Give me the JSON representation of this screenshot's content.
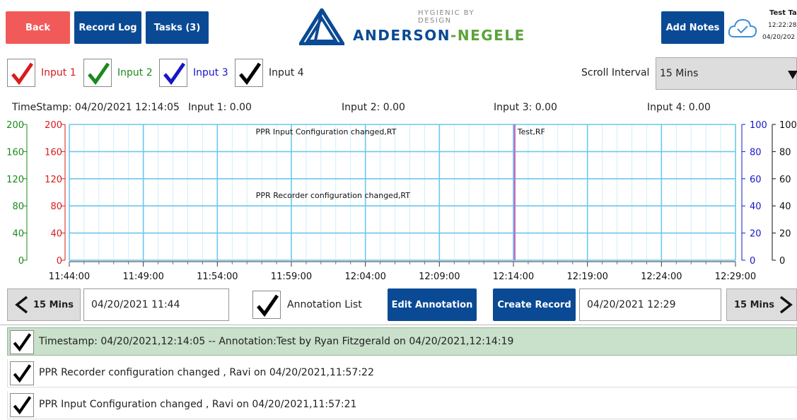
{
  "header": {
    "back_label": "Back",
    "record_log_label": "Record Log",
    "tasks_label": "Tasks (3)",
    "brand_tagline": "HYGIENIC BY DESIGN",
    "brand_name_a": "ANDERSON",
    "brand_name_sep": "-",
    "brand_name_b": "NEGELE",
    "add_notes_label": "Add Notes",
    "tag_name": "Test Tag",
    "time": "12:22:28",
    "date": "04/20/202"
  },
  "inputs": [
    {
      "label": "Input 1",
      "color": "#d81b1b"
    },
    {
      "label": "Input 2",
      "color": "#1a8a1a"
    },
    {
      "label": "Input 3",
      "color": "#1616c8"
    },
    {
      "label": "Input 4",
      "color": "#000000"
    }
  ],
  "scroll": {
    "label": "Scroll Interval",
    "value": "15 Mins"
  },
  "readout": {
    "timestamp": "TimeStamp: 04/20/2021 12:14:05",
    "input1": "Input 1: 0.00",
    "input2": "Input 2: 0.00",
    "input3": "Input 3: 0.00",
    "input4": "Input 4: 0.00"
  },
  "chart_data": {
    "type": "line",
    "x_ticks": [
      "11:44:00",
      "11:49:00",
      "11:54:00",
      "11:59:00",
      "12:04:00",
      "12:09:00",
      "12:14:00",
      "12:19:00",
      "12:24:00",
      "12:29:00"
    ],
    "y_axes": {
      "green": [
        "0",
        "40",
        "80",
        "120",
        "160",
        "200"
      ],
      "red": [
        "0",
        "40",
        "80",
        "120",
        "160",
        "200"
      ],
      "blue": [
        "0",
        "20",
        "40",
        "60",
        "80",
        "100"
      ],
      "black": [
        "0",
        "20",
        "40",
        "60",
        "80",
        "100"
      ]
    },
    "annotations": [
      {
        "text": "PPR Input Configuration changed,RT",
        "time": "11:57:21"
      },
      {
        "text": "PPR Recorder configuration changed,RT",
        "time": "11:57:22"
      },
      {
        "text": "Test,RF",
        "time": "12:14:05"
      }
    ],
    "marker_time": "12:14:05"
  },
  "nav": {
    "prev_label": "15 Mins",
    "start_time": "04/20/2021 11:44",
    "annotation_list_label": "Annotation List",
    "edit_annotation_label": "Edit Annotation",
    "create_record_label": "Create Record",
    "end_time": "04/20/2021 12:29",
    "next_label": "15 Mins"
  },
  "annotations_list": [
    {
      "text": "Timestamp: 04/20/2021,12:14:05 -- Annotation:Test by Ryan Fitzgerald on 04/20/2021,12:14:19"
    },
    {
      "text": "PPR Recorder configuration changed , Ravi on 04/20/2021,11:57:22"
    },
    {
      "text": "PPR Input Configuration changed , Ravi on 04/20/2021,11:57:21"
    }
  ]
}
